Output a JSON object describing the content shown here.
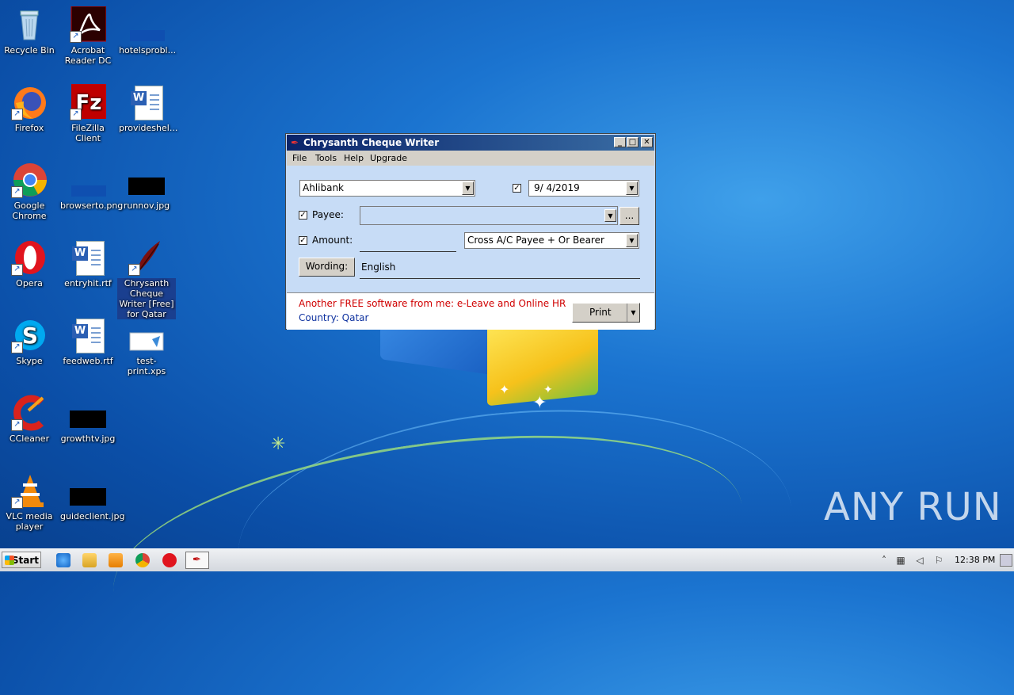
{
  "desktop_icons": [
    {
      "label": "Recycle Bin"
    },
    {
      "label": "Acrobat Reader DC"
    },
    {
      "label": "hotelsprobl..."
    },
    {
      "label": "Firefox"
    },
    {
      "label": "FileZilla Client"
    },
    {
      "label": "provideshel..."
    },
    {
      "label": "Google Chrome"
    },
    {
      "label": "browserto.png"
    },
    {
      "label": "runnov.jpg"
    },
    {
      "label": "Opera"
    },
    {
      "label": "entryhit.rtf"
    },
    {
      "label": "Chrysanth Cheque Writer [Free] for Qatar"
    },
    {
      "label": "Skype"
    },
    {
      "label": "feedweb.rtf"
    },
    {
      "label": "test-print.xps"
    },
    {
      "label": "CCleaner"
    },
    {
      "label": "growthtv.jpg"
    },
    {
      "label": "VLC media player"
    },
    {
      "label": "guideclient.jpg"
    }
  ],
  "window": {
    "title": "Chrysanth Cheque Writer",
    "menu": [
      "File",
      "Tools",
      "Help",
      "Upgrade"
    ],
    "bank": "Ahlibank",
    "date_checked": "✓",
    "date": "9/  4/2019",
    "payee_label": "Payee:",
    "payee_checked": "✓",
    "payee_value": "",
    "browse_label": "...",
    "amount_label": "Amount:",
    "amount_checked": "✓",
    "amount_value": "",
    "crossing": "Cross A/C Payee + Or Bearer",
    "wording_button": "Wording:",
    "wording_value": "English",
    "promo": "Another FREE software from me: e-Leave and Online HR",
    "country": "Country: Qatar",
    "print_label": "Print"
  },
  "taskbar": {
    "start_label": "Start",
    "clock": "12:38 PM"
  },
  "watermark": "ANY RUN"
}
